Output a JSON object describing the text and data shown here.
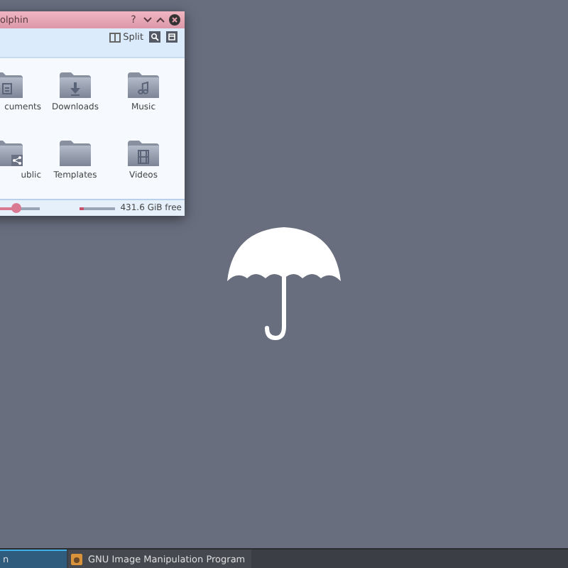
{
  "window": {
    "title": "olphin",
    "help_label": "?",
    "split_label": "Split",
    "folders": [
      {
        "label": "cuments",
        "kind": "documents"
      },
      {
        "label": "Downloads",
        "kind": "downloads"
      },
      {
        "label": "Music",
        "kind": "music"
      },
      {
        "label": "ublic",
        "kind": "public"
      },
      {
        "label": "Templates",
        "kind": "plain"
      },
      {
        "label": "Videos",
        "kind": "videos"
      }
    ],
    "zoom_slider": {
      "level": 0.4
    },
    "disk_usage": {
      "level": 0.12
    },
    "free_space": "431.6 GiB free"
  },
  "taskbar": {
    "tasks": [
      {
        "label": "n",
        "selected": true
      },
      {
        "label": "GNU Image Manipulation Program",
        "selected": false
      }
    ]
  }
}
